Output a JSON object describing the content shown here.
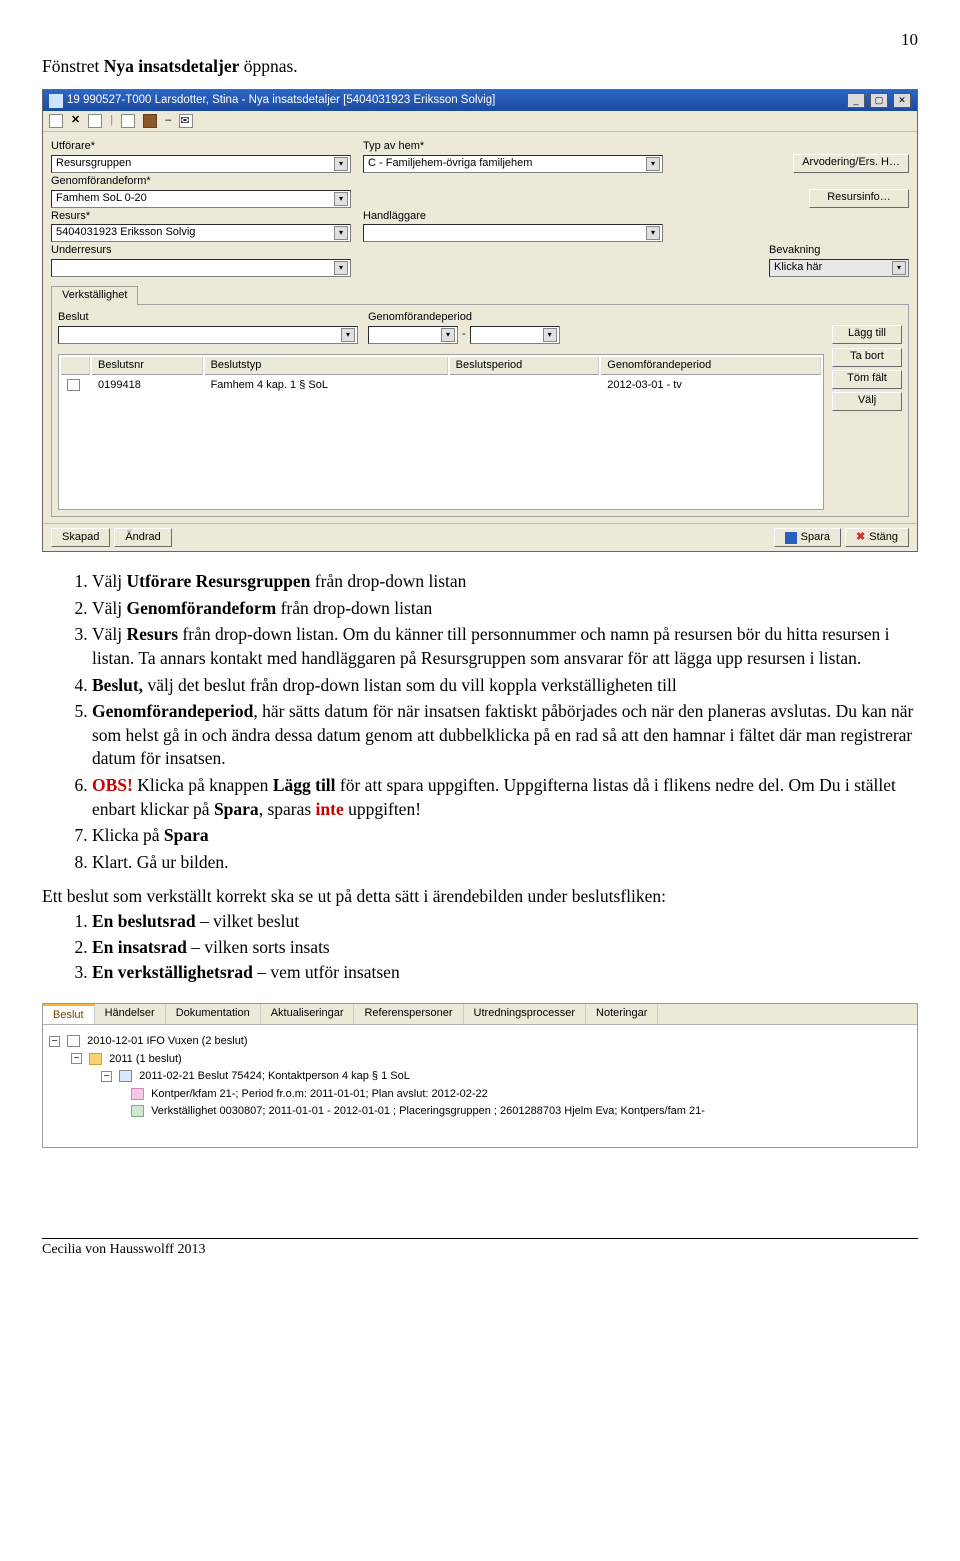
{
  "page_number": "10",
  "intro": "Fönstret Nya insatsdetaljer öppnas.",
  "shot1": {
    "title": "19 990527-T000  Larsdotter, Stina   -   Nya insatsdetaljer   [5404031923 Eriksson Solvig]",
    "toolbar_icons": [
      "doc-icon",
      "x-icon",
      "sheet-icon",
      "pin-icon",
      "book-icon",
      "dash-icon",
      "mail-icon"
    ],
    "fields": {
      "utforare_label": "Utförare*",
      "utforare_value": "Resursgruppen",
      "typavhem_label": "Typ av hem*",
      "typavhem_value": "C - Familjehem-övriga familjehem",
      "genomforandeform_label": "Genomförandeform*",
      "genomforandeform_value": "Famhem SoL 0-20",
      "resurs_label": "Resurs*",
      "resurs_value": "5404031923 Eriksson Solvig",
      "handlaggare_label": "Handläggare",
      "underresurs_label": "Underresurs",
      "bevakning_label": "Bevakning",
      "bevakning_value": "Klicka här"
    },
    "side_buttons": {
      "arv": "Arvodering/Ers. H…",
      "resursinfo": "Resursinfo…"
    },
    "tab": {
      "name": "Verkställighet",
      "beslut_label": "Beslut",
      "genomperiod_label": "Genomförandeperiod",
      "buttons": {
        "lagg": "Lägg till",
        "tabort": "Ta bort",
        "tomfalt": "Töm fält",
        "valj": "Välj"
      },
      "columns": {
        "beslutsnr": "Beslutsnr",
        "beslutstyp": "Beslutstyp",
        "beslutsperiod": "Beslutsperiod",
        "genomforandeperiod": "Genomförandeperiod"
      },
      "row": {
        "beslutsnr": "0199418",
        "beslutstyp": "Famhem 4 kap. 1 § SoL",
        "beslutsperiod": "",
        "genomforandeperiod": "2012-03-01 - tv"
      }
    },
    "bottom": {
      "skapad": "Skapad",
      "andrad": "Ändrad",
      "spara": "Spara",
      "stang": "Stäng"
    }
  },
  "list": {
    "i1a": "Välj ",
    "i1b": "Utförare Resursgruppen",
    "i1c": " från drop-down listan",
    "i2a": "Välj ",
    "i2b": "Genomförandeform",
    "i2c": " från drop-down listan",
    "i3a": "Välj ",
    "i3b": "Resurs",
    "i3c": " från drop-down listan. Om du känner till personnummer och namn på resursen bör du hitta resursen i listan. Ta annars kontakt med handläggaren på Resursgruppen som ansvarar för att lägga upp resursen i listan.",
    "i4a": "Beslut,",
    "i4b": " välj det beslut från drop-down listan som du vill koppla verkställigheten till",
    "i5a": "Genomförandeperiod",
    "i5b": ", här sätts datum för när insatsen faktiskt påbörjades och när den planeras avslutas. Du kan när som helst gå in och ändra dessa datum genom att dubbelklicka på en rad så att den hamnar i fältet där man registrerar datum för insatsen.",
    "i6a": "OBS!",
    "i6b": " Klicka på knappen ",
    "i6c": "Lägg till",
    "i6d": " för att spara uppgiften. Uppgifterna listas då i flikens nedre del. Om Du i stället enbart klickar på ",
    "i6e": "Spara",
    "i6f": ", sparas ",
    "i6g": "inte",
    "i6h": " uppgiften!",
    "i7a": "Klicka på ",
    "i7b": "Spara",
    "i8": "Klart. Gå ur bilden."
  },
  "post_para": "Ett beslut som verkställt korrekt ska se ut på detta sätt i ärendebilden under beslutsfliken:",
  "sec_list": {
    "s1a": "En beslutsrad",
    "s1b": " – vilket beslut",
    "s2a": "En insatsrad",
    "s2b": " – vilken sorts insats",
    "s3a": "En verkställighetsrad",
    "s3b": " – vem utför insatsen"
  },
  "shot2": {
    "tabs": [
      "Beslut",
      "Händelser",
      "Dokumentation",
      "Aktualiseringar",
      "Referenspersoner",
      "Utredningsprocesser",
      "Noteringar"
    ],
    "n1": "2010-12-01  IFO Vuxen (2 beslut)",
    "n2": "2011   (1 beslut)",
    "n3": "2011-02-21  Beslut 75424; Kontaktperson 4 kap § 1 SoL",
    "n4": "Kontper/kfam 21-; Period fr.o.m: 2011-01-01; Plan avslut: 2012-02-22",
    "n5": "Verkställighet 0030807; 2011-01-01 - 2012-01-01 ; Placeringsgruppen ; 2601288703 Hjelm Eva; Kontpers/fam 21-"
  },
  "footer": "Cecilia von Hausswolff 2013"
}
